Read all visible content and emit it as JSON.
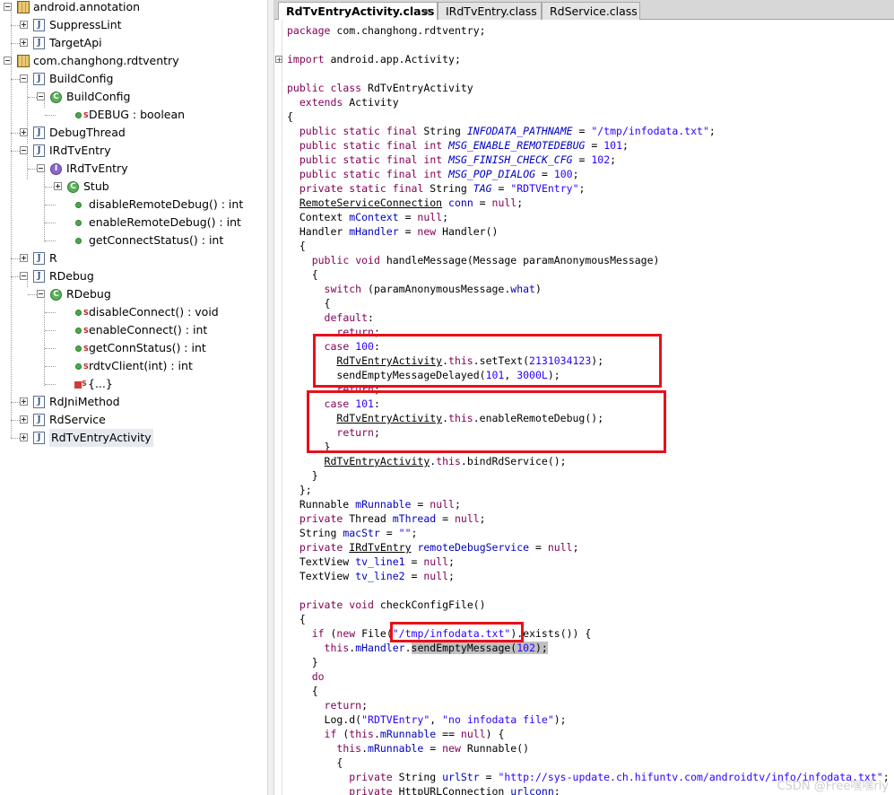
{
  "tree": {
    "items": [
      {
        "label": "android.annotation",
        "icon": "package-icon"
      },
      {
        "label": "SuppressLint",
        "icon": "java-file-icon"
      },
      {
        "label": "TargetApi",
        "icon": "java-file-icon"
      },
      {
        "label": "com.changhong.rdtventry",
        "icon": "package-icon"
      },
      {
        "label": "BuildConfig",
        "icon": "java-file-icon"
      },
      {
        "label": "BuildConfig",
        "icon": "class-icon"
      },
      {
        "label": "DEBUG : boolean",
        "icon": "static-field-icon"
      },
      {
        "label": "DebugThread",
        "icon": "java-file-icon"
      },
      {
        "label": "IRdTvEntry",
        "icon": "java-file-icon"
      },
      {
        "label": "IRdTvEntry",
        "icon": "interface-icon"
      },
      {
        "label": "Stub",
        "icon": "class-icon"
      },
      {
        "label": "disableRemoteDebug() : int",
        "icon": "method-icon"
      },
      {
        "label": "enableRemoteDebug() : int",
        "icon": "method-icon"
      },
      {
        "label": "getConnectStatus() : int",
        "icon": "method-icon"
      },
      {
        "label": "R",
        "icon": "java-file-icon"
      },
      {
        "label": "RDebug",
        "icon": "java-file-icon"
      },
      {
        "label": "RDebug",
        "icon": "class-icon"
      },
      {
        "label": "disableConnect() : void",
        "icon": "static-method-icon"
      },
      {
        "label": "enableConnect() : int",
        "icon": "static-method-icon"
      },
      {
        "label": "getConnStatus() : int",
        "icon": "static-method-icon"
      },
      {
        "label": "rdtvClient(int) : int",
        "icon": "static-method-icon"
      },
      {
        "label": "{...}",
        "icon": "static-init-icon"
      },
      {
        "label": "RdJniMethod",
        "icon": "java-file-icon"
      },
      {
        "label": "RdService",
        "icon": "java-file-icon"
      },
      {
        "label": "RdTvEntryActivity",
        "icon": "java-file-icon"
      }
    ],
    "icon_marks": {
      "java": "J",
      "class": "C",
      "interface": "I",
      "static": "S",
      "field_static": "oS"
    }
  },
  "tabs": [
    {
      "label": "RdTvEntryActivity.class",
      "active": true,
      "close": "✕"
    },
    {
      "label": "IRdTvEntry.class",
      "active": false
    },
    {
      "label": "RdService.class",
      "active": false
    }
  ],
  "code": {
    "lines": [
      "package com.changhong.rdtventry;",
      "",
      "import android.app.Activity;",
      "",
      "public class RdTvEntryActivity",
      "  extends Activity",
      "{",
      "  public static final String INFODATA_PATHNAME = \"/tmp/infodata.txt\";",
      "  public static final int MSG_ENABLE_REMOTEDEBUG = 101;",
      "  public static final int MSG_FINISH_CHECK_CFG = 102;",
      "  public static final int MSG_POP_DIALOG = 100;",
      "  private static final String TAG = \"RDTVEntry\";",
      "  RemoteServiceConnection conn = null;",
      "  Context mContext = null;",
      "  Handler mHandler = new Handler()",
      "  {",
      "    public void handleMessage(Message paramAnonymousMessage)",
      "    {",
      "      switch (paramAnonymousMessage.what)",
      "      {",
      "      default:",
      "        return;",
      "      case 100:",
      "        RdTvEntryActivity.this.setText(2131034123);",
      "        sendEmptyMessageDelayed(101, 3000L);",
      "        return;",
      "      case 101:",
      "        RdTvEntryActivity.this.enableRemoteDebug();",
      "        return;",
      "      }",
      "      RdTvEntryActivity.this.bindRdService();",
      "    }",
      "  };",
      "  Runnable mRunnable = null;",
      "  private Thread mThread = null;",
      "  String macStr = \"\";",
      "  private IRdTvEntry remoteDebugService = null;",
      "  TextView tv_line1 = null;",
      "  TextView tv_line2 = null;",
      "",
      "  private void checkConfigFile()",
      "  {",
      "    if (new File(\"/tmp/infodata.txt\").exists()) {",
      "      this.mHandler.sendEmptyMessage(102);",
      "    }",
      "    do",
      "    {",
      "      return;",
      "      Log.d(\"RDTVEntry\", \"no infodata file\");",
      "      if (this.mRunnable == null) {",
      "        this.mRunnable = new Runnable()",
      "        {",
      "          private String urlStr = \"http://sys-update.ch.hifuntv.com/androidtv/info/infodata.txt\";",
      "          private HttpURLConnection urlconn;"
    ]
  },
  "watermark": "CSDN @Free嘿嘿rly"
}
